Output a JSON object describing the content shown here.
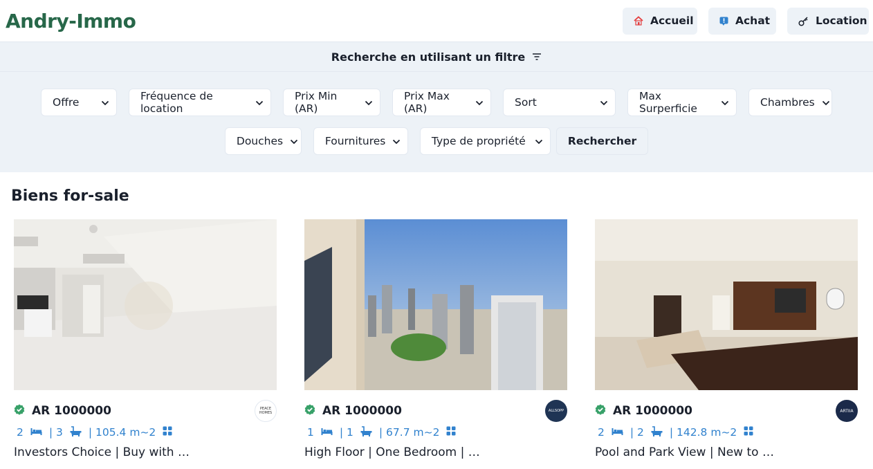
{
  "brand": {
    "name": "Andry-Immo",
    "color": "#276749"
  },
  "nav": [
    {
      "label": "Accueil",
      "icon": "house-icon"
    },
    {
      "label": "Achat",
      "icon": "info-icon"
    },
    {
      "label": "Location",
      "icon": "key-icon"
    }
  ],
  "filter": {
    "heading": "Recherche en utilisant un filtre",
    "row1": [
      "Offre",
      "Fréquence de location",
      "Prix Min (AR)",
      "Prix Max (AR)",
      "Sort",
      "Max Surperficie",
      "Chambres"
    ],
    "row2": [
      "Douches",
      "Fournitures",
      "Type de propriété"
    ],
    "search_label": "Rechercher"
  },
  "listing": {
    "heading": "Biens for-sale",
    "cards": [
      {
        "price": "AR 1000000",
        "rooms": "2",
        "baths": "| 3",
        "area": "| 105.4 m~2",
        "title": "Investors Choice | Buy with C...",
        "agency": "PEACE HOMES"
      },
      {
        "price": "AR 1000000",
        "rooms": "1",
        "baths": "| 1",
        "area": "| 67.7 m~2",
        "title": "High Floor | One Bedroom | Bes...",
        "agency": "ALLSOPP"
      },
      {
        "price": "AR 1000000",
        "rooms": "2",
        "baths": "| 2",
        "area": "| 142.8 m~2",
        "title": "Pool and Park View | New to Ma...",
        "agency": "ARTIIA"
      }
    ]
  },
  "colors": {
    "accent": "#3182ce",
    "verified": "#38a169",
    "panel": "#edf2f7"
  }
}
